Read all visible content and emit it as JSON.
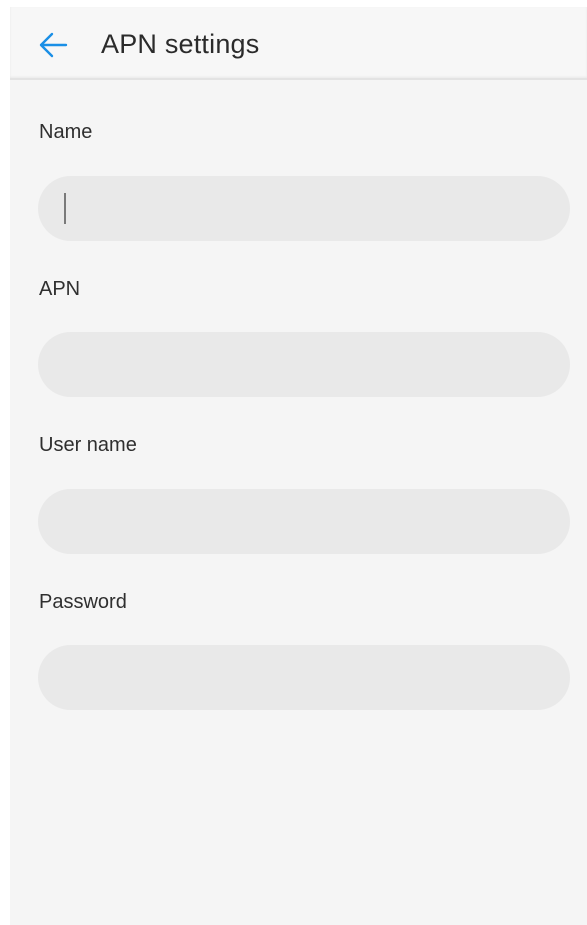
{
  "header": {
    "title": "APN settings",
    "back_icon": "arrow-left-icon",
    "accent_color": "#1a8fe6"
  },
  "form": {
    "fields": [
      {
        "label": "Name",
        "value": "",
        "focused": true
      },
      {
        "label": "APN",
        "value": ""
      },
      {
        "label": "User name",
        "value": ""
      },
      {
        "label": "Password",
        "value": ""
      }
    ]
  }
}
